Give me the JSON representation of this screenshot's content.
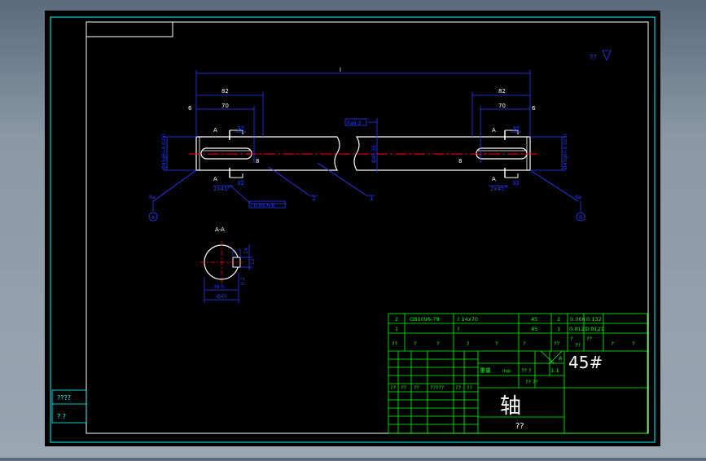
{
  "drawing": {
    "colors": {
      "background": "#000000",
      "frame": "#00ffff",
      "border": "#ffffff",
      "dimension": "#0000ff",
      "centerline": "#ff0000",
      "table": "#00ff00",
      "cyan_text": "#00ffff"
    },
    "dims": {
      "overall": "l",
      "left_82": "82",
      "left_70": "70",
      "right_82": "82",
      "right_70": "70",
      "left_6": "6",
      "right_6": "6",
      "left_8": "8",
      "right_8": "8",
      "dia_left": "Ø45g6(-0.025)",
      "dia_right": "Ø45g6(-0.025)",
      "dia_mid": "Ø45.35",
      "ra_mid": "Ra6.3",
      "tol_box_bottom": "/ 0.05 A-B",
      "chamfer_left": "2x45°",
      "chamfer_right": "2x45°",
      "a_tl": "A",
      "a_bl": "A",
      "a_tr": "A",
      "a_br": "A",
      "dim_32a": "32",
      "dim_32b": "32",
      "dim_32c": "32",
      "dim_32d": "32",
      "leader_2": "2",
      "leader_1": "1",
      "bubble_a": "A",
      "bubble_b": "B",
      "ra_a": "Ra",
      "ra_b": "Ra"
    },
    "notes": {
      "top_right_mark": "??"
    },
    "section": {
      "label": "A-A",
      "dim_top": "14",
      "dim_width": "12",
      "dim_depth": "39.5",
      "dim_dia": "Ø45",
      "dim_side": "0.2"
    },
    "parts_table": {
      "row1": [
        "2",
        "GB1096-79",
        "? 14x70",
        "45",
        "2",
        "0.066",
        "0.132"
      ],
      "row2": [
        "1",
        "",
        "?",
        "45",
        "1",
        "0.0121",
        "0.0121"
      ],
      "header": [
        "??",
        "?",
        "?",
        "?",
        "?",
        "?",
        "??",
        "?",
        "??",
        "??",
        "?",
        "?"
      ]
    },
    "title_block": {
      "material": "45#",
      "part_name": "轴",
      "sub_name": "??",
      "row_labels": [
        "??",
        "??",
        "??",
        "?????",
        "??",
        "??"
      ],
      "mark_text": "?? ??",
      "weight_label": "?? ?",
      "scale_label": "1:1",
      "label_a": "重量",
      "label_b": "(kg)",
      "sheet": "A"
    },
    "side_stamp": {
      "line1": "????",
      "line2": "?     ?"
    }
  }
}
